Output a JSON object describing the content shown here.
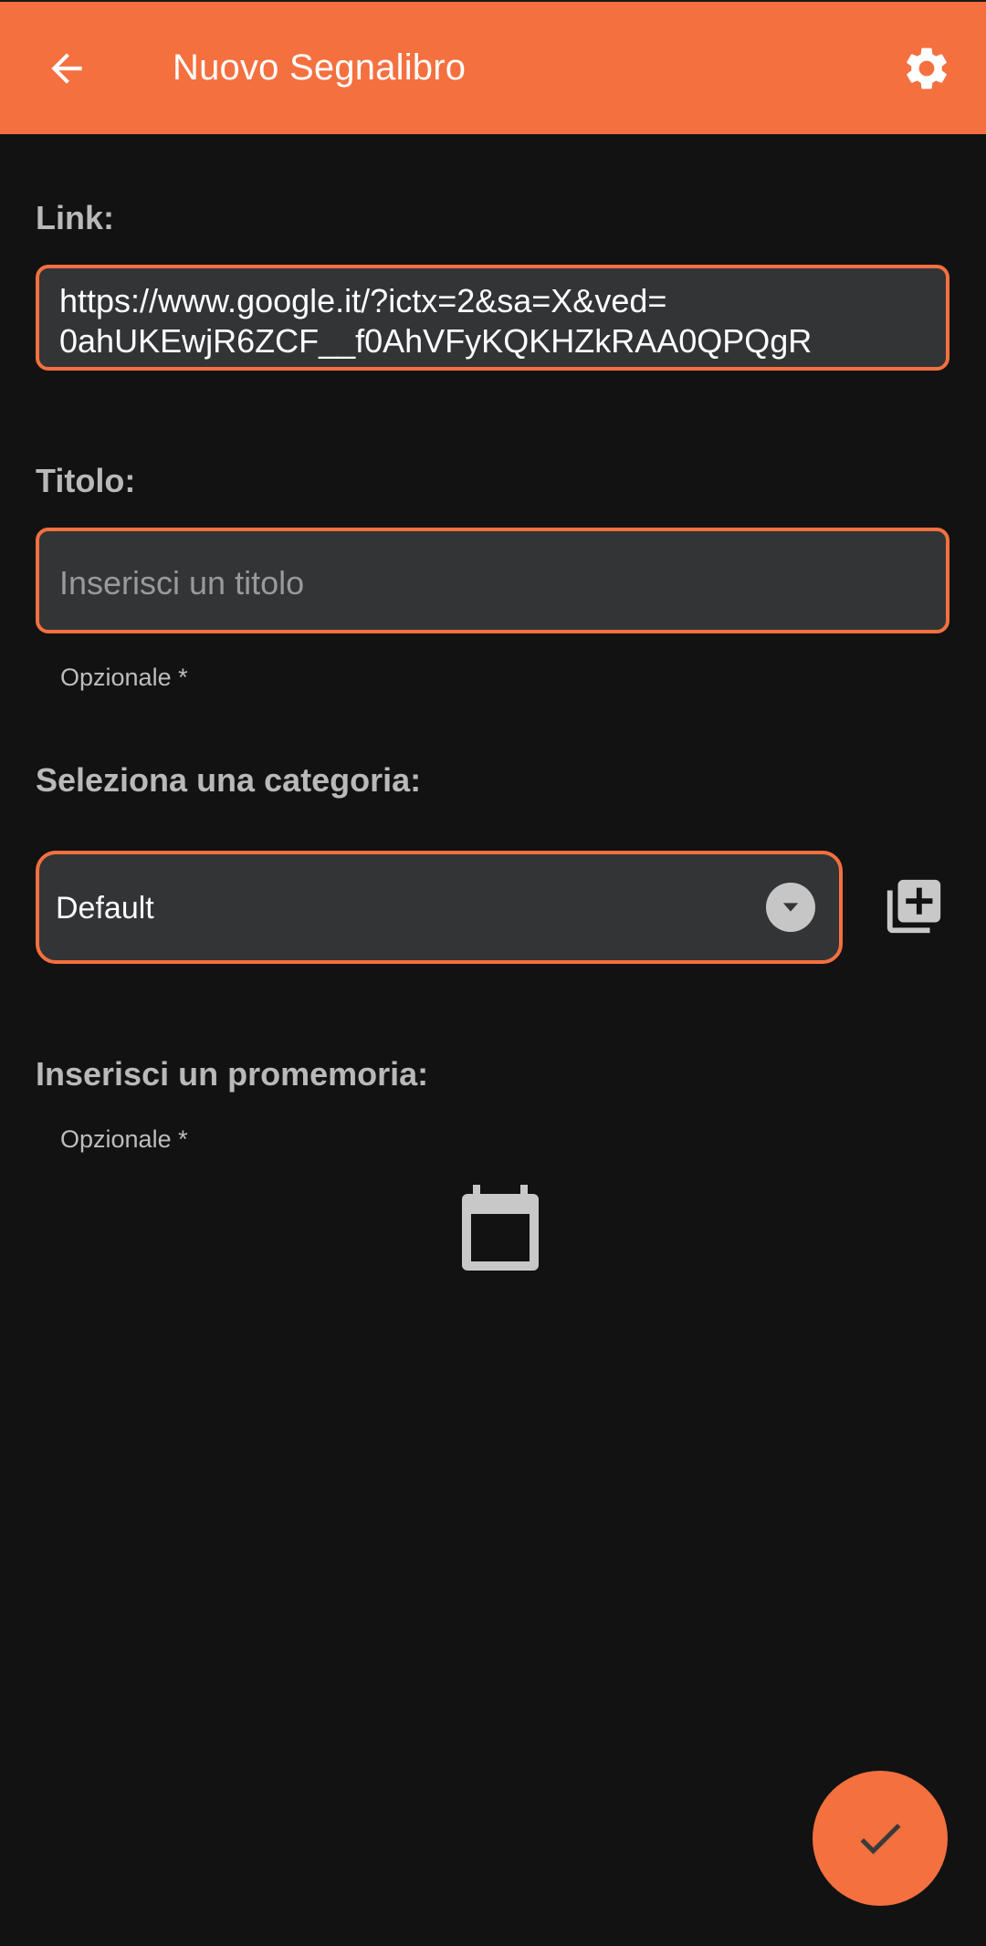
{
  "appbar": {
    "title": "Nuovo Segnalibro",
    "back_icon": "arrow-back-icon",
    "settings_icon": "gear-icon"
  },
  "link": {
    "label": "Link:",
    "value": "https://www.google.it/?ictx=2&sa=X&ved=\n0ahUKEwjR6ZCF__f0AhVFyKQKHZkRAA0QPQgR"
  },
  "title_field": {
    "label": "Titolo:",
    "placeholder": "Inserisci un titolo",
    "helper": "Opzionale *"
  },
  "category": {
    "label": "Seleziona una categoria:",
    "selected": "Default",
    "add_icon": "library-add-icon"
  },
  "reminder": {
    "label": "Inserisci un promemoria:",
    "helper": "Opzionale *",
    "calendar_icon": "calendar-icon"
  },
  "fab": {
    "icon": "check-icon"
  },
  "colors": {
    "accent": "#F4703F",
    "background": "#121212",
    "field": "#323436"
  }
}
